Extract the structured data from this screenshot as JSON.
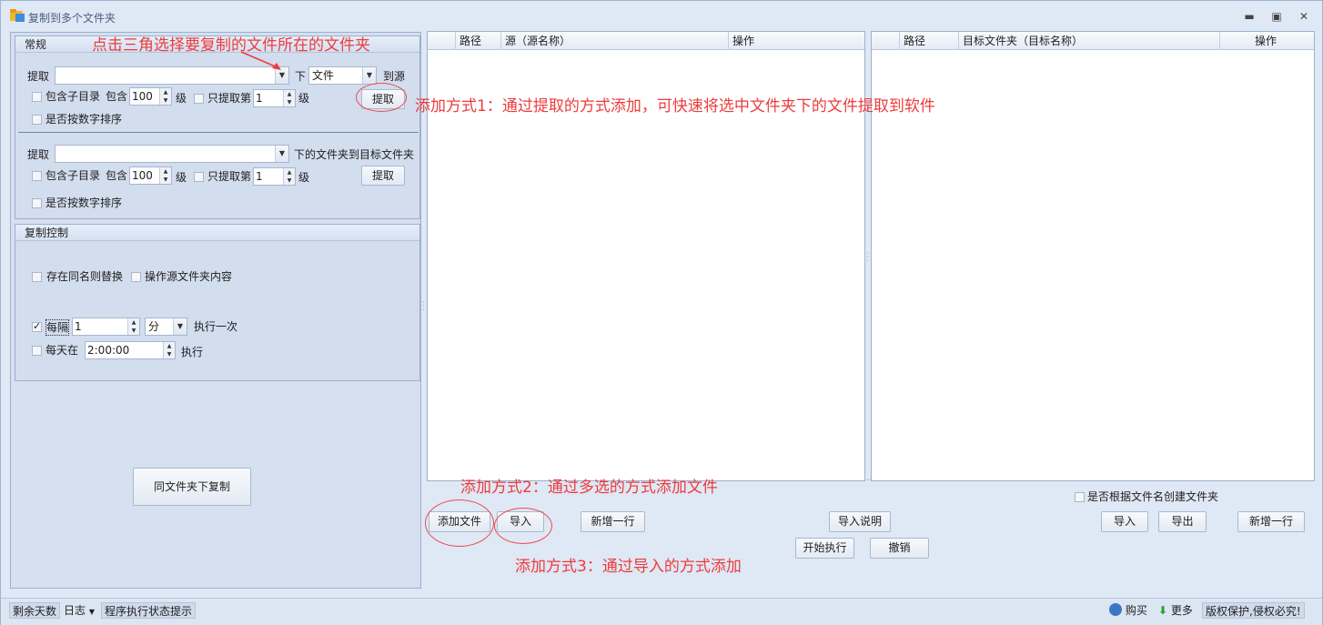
{
  "window": {
    "title": "复制到多个文件夹",
    "controls": [
      "minimize-icon",
      "restore-icon",
      "close-icon"
    ]
  },
  "left": {
    "general_group": {
      "header": "常规",
      "row1": {
        "extract_label": "提取",
        "path_value": "",
        "below_label": "下",
        "type_value": "文件",
        "to_source_label": "到源"
      },
      "row2": {
        "include_subdir_label": "包含子目录",
        "include_label": "包含",
        "include_value": "100",
        "level_label": "级",
        "only_extract_label": "只提取第",
        "only_value": "1",
        "level2_label": "级",
        "extract_button": "提取"
      },
      "row3": {
        "numeric_sort_label": "是否按数字排序"
      },
      "row4": {
        "extract_label": "提取",
        "path_value": "",
        "folder_to_target_label": "下的文件夹到目标文件夹"
      },
      "row5": {
        "include_subdir_label": "包含子目录",
        "include_label": "包含",
        "include_value": "100",
        "level_label": "级",
        "only_extract_label": "只提取第",
        "only_value": "1",
        "level2_label": "级",
        "extract_button": "提取"
      },
      "row6": {
        "numeric_sort_label": "是否按数字排序"
      }
    },
    "copy_control_group": {
      "header": "复制控制",
      "replace_label": "存在同名则替换",
      "operate_source_label": "操作源文件夹内容",
      "every_label": "每隔",
      "every_value": "1",
      "unit_value": "分",
      "execute_once_label": "执行一次",
      "daily_label": "每天在",
      "daily_time": "2:00:00",
      "execute_label": "执行",
      "every_checked": true
    },
    "same_folder_button": "同文件夹下复制"
  },
  "source_grid": {
    "columns": [
      "路径",
      "源（源名称）",
      "操作"
    ]
  },
  "target_grid": {
    "columns": [
      "路径",
      "目标文件夹（目标名称）",
      "操作"
    ]
  },
  "actions": {
    "add_file": "添加文件",
    "import": "导入",
    "add_row": "新增一行",
    "import_help": "导入说明",
    "start": "开始执行",
    "cancel": "撤销",
    "create_folder_label": "是否根据文件名创建文件夹",
    "target_import": "导入",
    "target_export": "导出",
    "target_add_row": "新增一行"
  },
  "annotations": {
    "triangle_hint": "点击三角选择要复制的文件所在的文件夹",
    "method1": "添加方式1：通过提取的方式添加，可快速将选中文件夹下的文件提取到软件",
    "method2": "添加方式2：通过多选的方式添加文件",
    "method3": "添加方式3：通过导入的方式添加"
  },
  "statusbar": {
    "days_left": "剩余天数",
    "log": "日志",
    "status_hint": "程序执行状态提示",
    "buy": "购买",
    "more": "更多",
    "copyright": "版权保护,侵权必究!"
  },
  "colors": {
    "annotation": "#ee3b3b",
    "window_bg": "#dfe8f5"
  }
}
